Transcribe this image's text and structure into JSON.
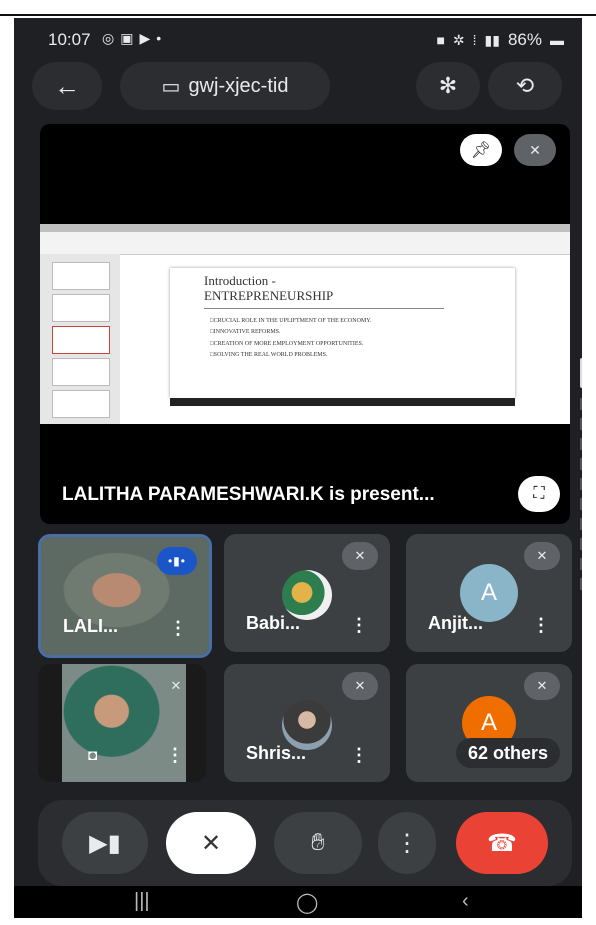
{
  "status_bar": {
    "time": "10:07",
    "battery": "86%"
  },
  "top_bar": {
    "meeting_code": "gwj-xjec-tid"
  },
  "presentation": {
    "presenter_label": "LALITHA PARAMESHWARI.K is present...",
    "slide": {
      "title_line1": "Introduction -",
      "title_line2": "ENTREPRENEURSHIP",
      "bullets": [
        "CRUCIAL ROLE IN THE UPLIFTMENT OF THE ECONOMY.",
        "INNOVATIVE REFORMS.",
        "CREATION OF MORE EMPLOYMENT OPPORTUNITIES.",
        "SOLVING THE REAL WORLD PROBLEMS."
      ]
    }
  },
  "participants": [
    {
      "name": "LALI...",
      "tile": "video",
      "speaking": true
    },
    {
      "name": "Babi...",
      "tile": "photo-avatar",
      "muted": true
    },
    {
      "name": "Anjit...",
      "tile": "letter-avatar",
      "initial": "A",
      "avatar_color": "#8ab4c8",
      "muted": true
    },
    {
      "name": "",
      "tile": "self-video",
      "muted": true
    },
    {
      "name": "Shris...",
      "tile": "photo-avatar",
      "muted": true
    },
    {
      "name": "62 others",
      "tile": "others",
      "initial": "A",
      "avatar_color": "#f06d00",
      "muted": true
    }
  ],
  "colors": {
    "end_call": "#ea4335",
    "speaking": "#1a56c8",
    "background": "#1f2023"
  },
  "icons": {
    "back": "arrow-left-icon",
    "meeting": "calendar-icon",
    "bluetooth": "bluetooth-icon",
    "switch_camera": "camera-switch-icon",
    "pin": "pin-icon",
    "mic_off": "mic-off-icon",
    "fullscreen": "fullscreen-icon",
    "camera": "video-camera-icon",
    "raise_hand": "hand-icon",
    "more": "more-vert-icon",
    "end_call": "phone-end-icon"
  }
}
